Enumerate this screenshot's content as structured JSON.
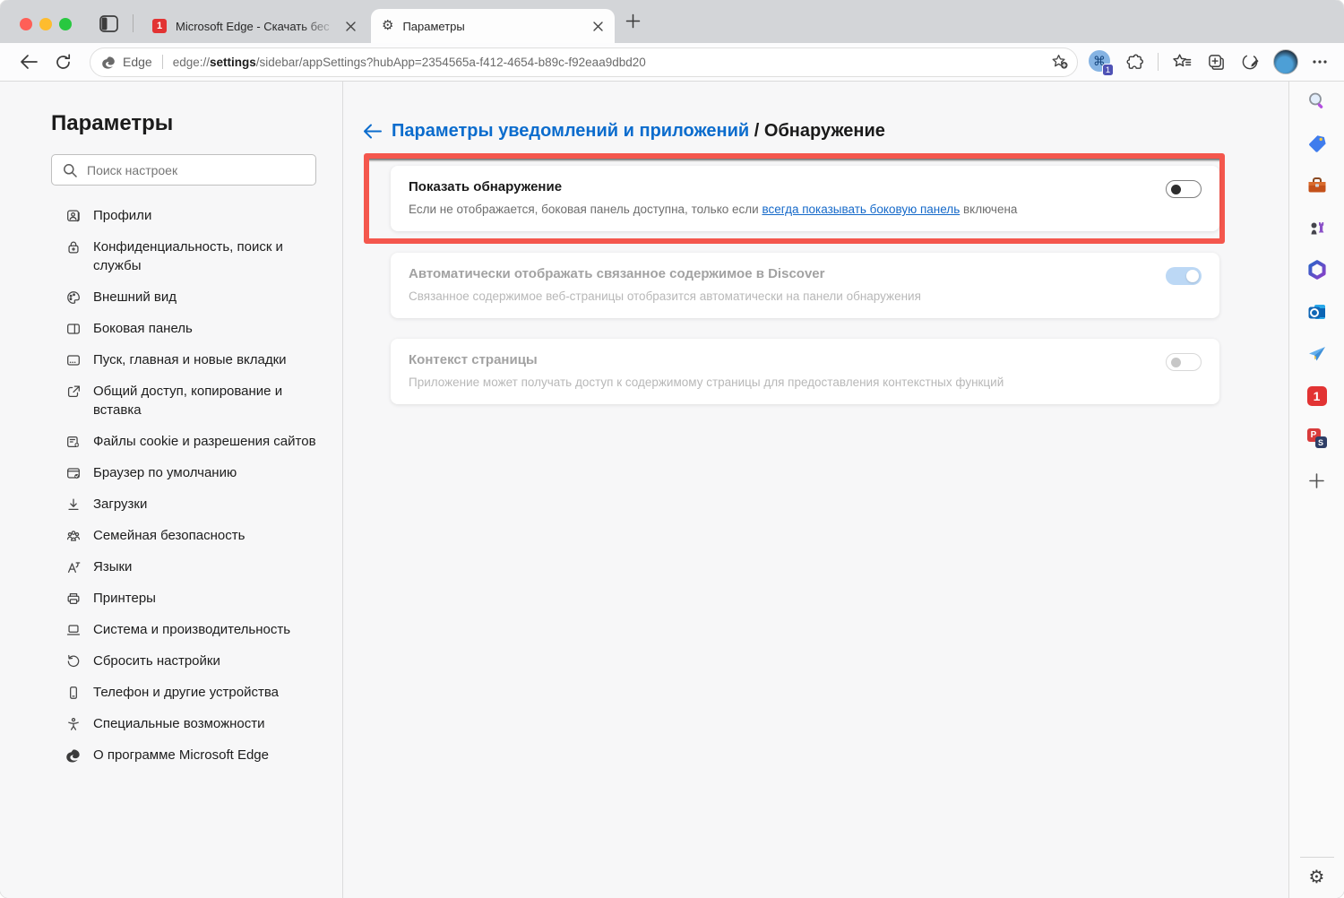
{
  "tab_strip": {
    "tabs": [
      {
        "title": "Microsoft Edge - Скачать бес",
        "favicon": "red-1-icon",
        "favicon_text": "1",
        "active": false
      },
      {
        "title": "Параметры",
        "favicon": "gear-icon",
        "active": true
      }
    ]
  },
  "toolbar": {
    "site_chip_label": "Edge",
    "url": {
      "scheme": "edge://",
      "host": "settings",
      "path": "/sidebar/appSettings?hubApp=2354565a-f412-4654-b89c-f92eaa9dbd20"
    },
    "extension_badge_count": "1"
  },
  "sidebar": {
    "title": "Параметры",
    "search_placeholder": "Поиск настроек",
    "items": [
      {
        "label": "Профили",
        "icon": "profiles-icon"
      },
      {
        "label": "Конфиденциальность, поиск и службы",
        "icon": "lock-icon"
      },
      {
        "label": "Внешний вид",
        "icon": "palette-icon"
      },
      {
        "label": "Боковая панель",
        "icon": "sidebar-panel-icon"
      },
      {
        "label": "Пуск, главная и новые вкладки",
        "icon": "start-home-icon"
      },
      {
        "label": "Общий доступ, копирование и вставка",
        "icon": "share-icon"
      },
      {
        "label": "Файлы cookie и разрешения сайтов",
        "icon": "cookies-icon"
      },
      {
        "label": "Браузер по умолчанию",
        "icon": "default-browser-icon"
      },
      {
        "label": "Загрузки",
        "icon": "downloads-icon"
      },
      {
        "label": "Семейная безопасность",
        "icon": "family-icon"
      },
      {
        "label": "Языки",
        "icon": "languages-icon"
      },
      {
        "label": "Принтеры",
        "icon": "printer-icon"
      },
      {
        "label": "Система и производительность",
        "icon": "system-icon"
      },
      {
        "label": "Сбросить настройки",
        "icon": "reset-icon"
      },
      {
        "label": "Телефон и другие устройства",
        "icon": "phone-icon"
      },
      {
        "label": "Специальные возможности",
        "icon": "accessibility-icon"
      },
      {
        "label": "О программе Microsoft Edge",
        "icon": "edge-logo-icon"
      }
    ]
  },
  "main": {
    "breadcrumb": {
      "link": "Параметры уведомлений и приложений",
      "separator": "/",
      "current": "Обнаружение"
    },
    "cards": [
      {
        "title": "Показать обнаружение",
        "desc_before": "Если не отображается, боковая панель доступна, только если ",
        "desc_link": "всегда показывать боковую панель",
        "desc_after": " включена",
        "toggle_state": "off",
        "enabled": true,
        "highlighted": true
      },
      {
        "title": "Автоматически отображать связанное содержимое в Discover",
        "desc": "Связанное содержимое веб-страницы отобразится автоматически на панели обнаружения",
        "toggle_state": "on",
        "enabled": false
      },
      {
        "title": "Контекст страницы",
        "desc": "Приложение может получать доступ к содержимому страницы для предоставления контекстных функций",
        "toggle_state": "off",
        "enabled": false
      }
    ]
  },
  "rail": {
    "icons": [
      "search-icon",
      "shopping-tag-icon",
      "toolbox-icon",
      "games-chess-icon",
      "microsoft-365-icon",
      "outlook-icon",
      "drop-plane-icon",
      "app-1-icon",
      "app-ps-icon",
      "add-icon"
    ],
    "app_1_text": "1",
    "app_ps_p": "P",
    "app_ps_s": "S"
  },
  "icons": {
    "gear_glyph": "⚙",
    "command_glyph": "⌘"
  },
  "colors": {
    "accent_blue": "#0b6ccd",
    "annotation_red": "#f4574d",
    "toggle_on_disabled": "#bcd8f5",
    "traffic_red": "#ff5f57",
    "traffic_yellow": "#febc2e",
    "traffic_green": "#28c840"
  }
}
